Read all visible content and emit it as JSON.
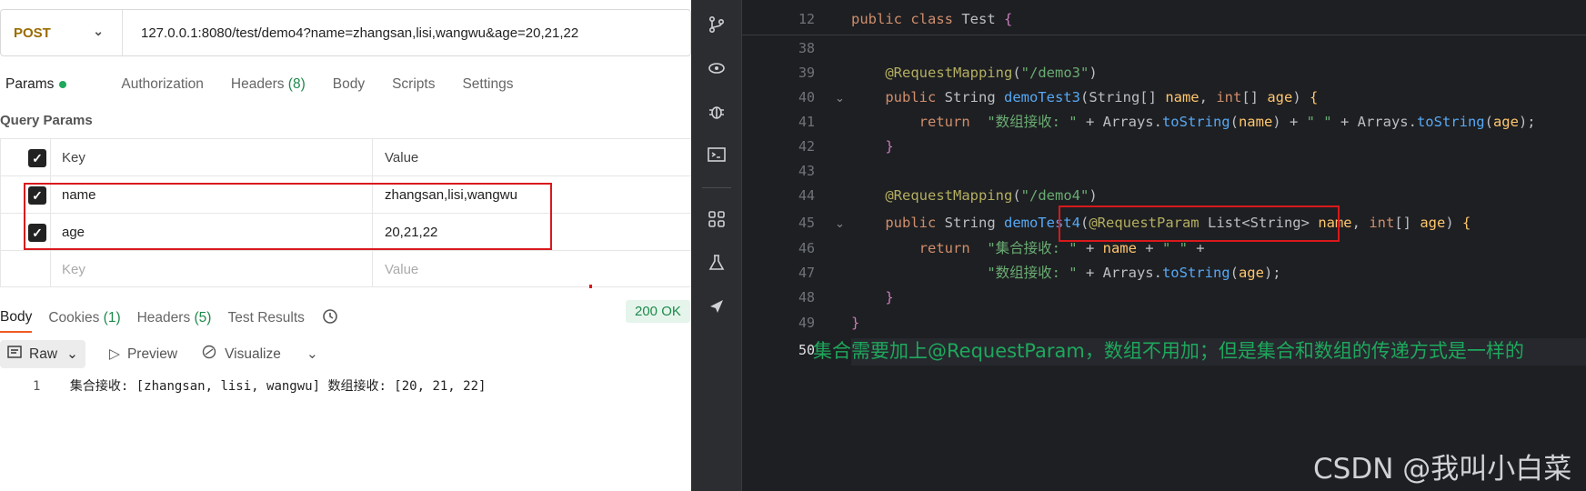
{
  "request": {
    "method": "POST",
    "url": "127.0.0.1:8080/test/demo4?name=zhangsan,lisi,wangwu&age=20,21,22"
  },
  "tabs": {
    "params": "Params",
    "authorization": "Authorization",
    "headers": "Headers",
    "headers_count": "(8)",
    "body": "Body",
    "scripts": "Scripts",
    "settings": "Settings"
  },
  "query_params": {
    "title": "Query Params",
    "header_key": "Key",
    "header_value": "Value",
    "rows": [
      {
        "key": "name",
        "value": "zhangsan,lisi,wangwu"
      },
      {
        "key": "age",
        "value": "20,21,22"
      }
    ],
    "placeholder_key": "Key",
    "placeholder_value": "Value"
  },
  "response": {
    "tabs": {
      "body": "Body",
      "cookies": "Cookies",
      "cookies_count": "(1)",
      "headers": "Headers",
      "headers_count": "(5)",
      "test_results": "Test Results"
    },
    "status": "200 OK",
    "tools": {
      "raw": "Raw",
      "preview": "Preview",
      "visualize": "Visualize"
    },
    "line_number": "1",
    "body_text": "集合接收: [zhangsan, lisi, wangwu] 数组接收: [20, 21, 22]"
  },
  "ide": {
    "line_numbers": [
      "12",
      "38",
      "39",
      "40",
      "41",
      "42",
      "43",
      "44",
      "45",
      "46",
      "47",
      "48",
      "49",
      "50"
    ],
    "annotation": "集合需要加上@RequestParam，数组不用加；但是集合和数组的传递方式是一样的",
    "watermark": "CSDN @我叫小白菜"
  },
  "colors": {
    "accent_green": "#1ea85c",
    "highlight_red": "#d9191c",
    "ide_background": "#1e1f22"
  },
  "icons": [
    "git-branch-icon",
    "eye-icon",
    "bug-icon",
    "terminal-icon",
    "grid-icon",
    "flask-icon",
    "send-icon",
    "history-icon",
    "raw-icon",
    "play-icon",
    "visualize-icon"
  ]
}
